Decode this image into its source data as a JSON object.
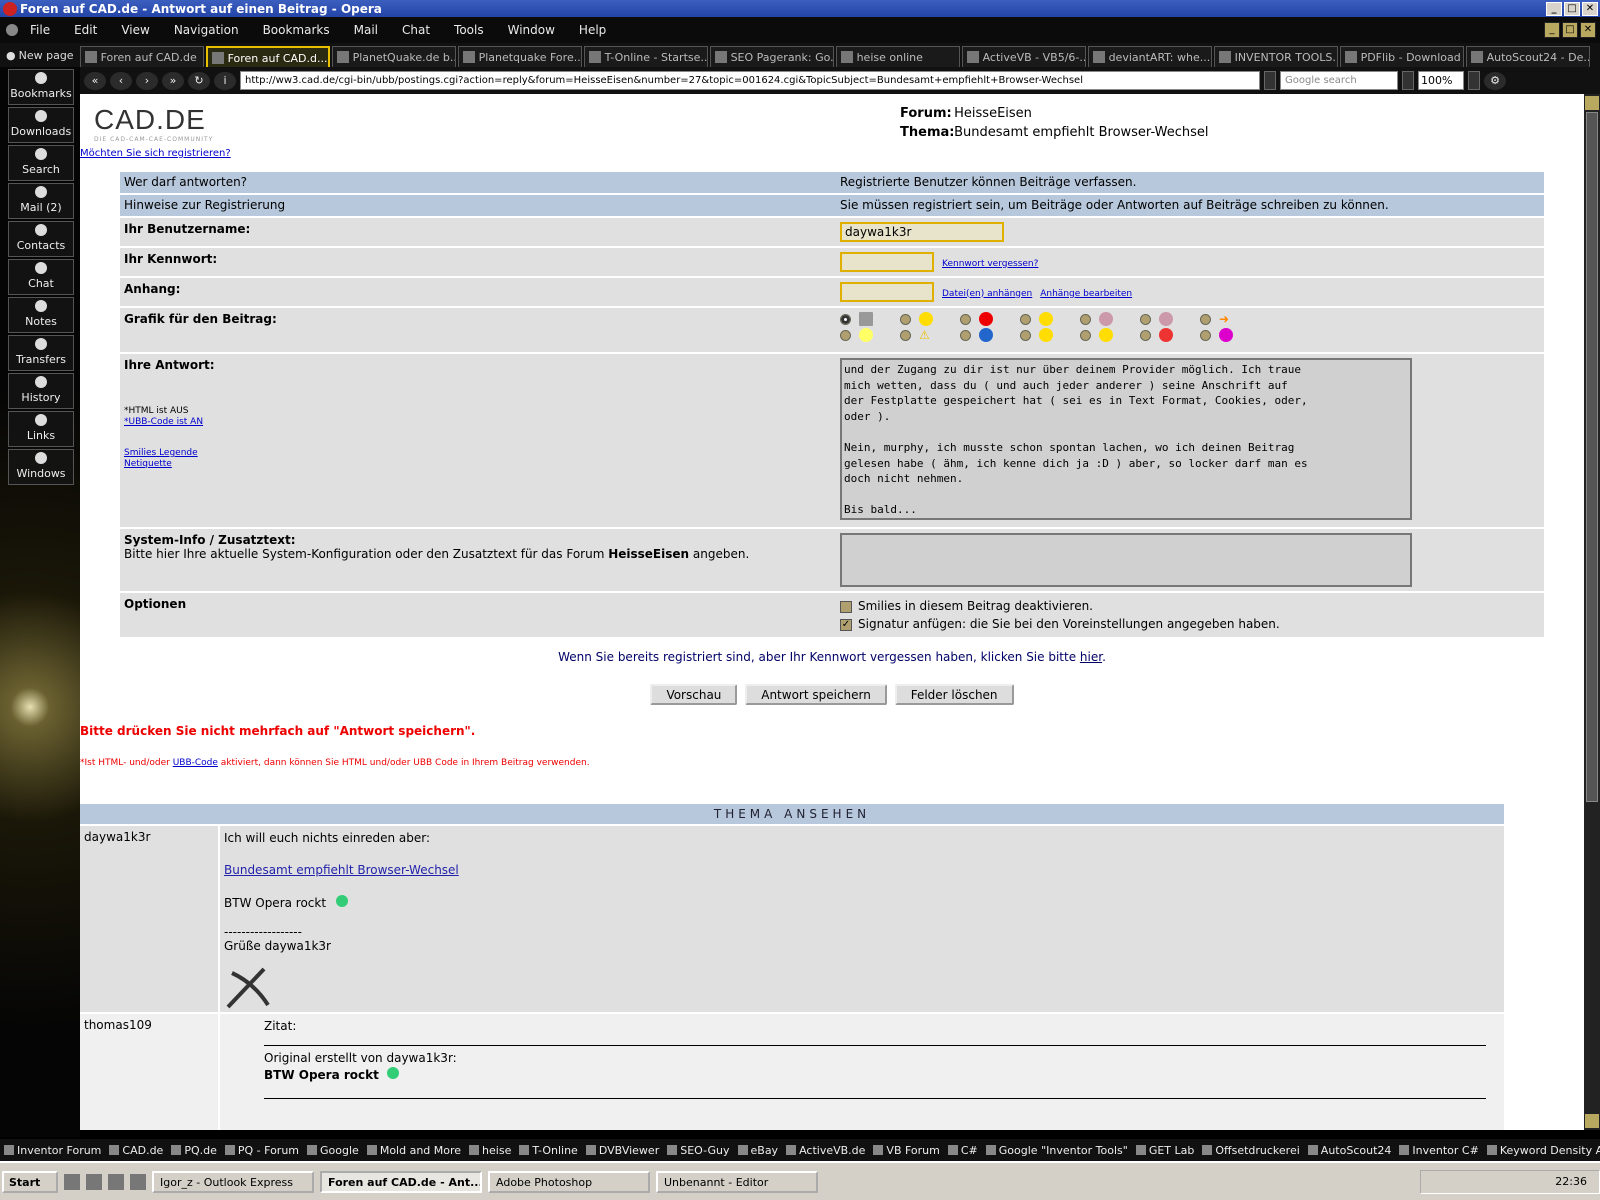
{
  "window": {
    "title": "Foren auf CAD.de - Antwort auf einen Beitrag - Opera"
  },
  "menu": [
    "File",
    "Edit",
    "View",
    "Navigation",
    "Bookmarks",
    "Mail",
    "Chat",
    "Tools",
    "Window",
    "Help"
  ],
  "tabs": {
    "new_page": "New page",
    "items": [
      "Foren auf CAD.de",
      "Foren auf CAD.d...",
      "PlanetQuake.de b...",
      "Planetquake Fore...",
      "T-Online - Startse...",
      "SEO Pagerank: Go...",
      "heise online",
      "ActiveVB - VB5/6-...",
      "deviantART: whe...",
      "INVENTOR TOOLS...",
      "PDFlib - Download ...",
      "AutoScout24 - De..."
    ]
  },
  "address": {
    "url": "http://ww3.cad.de/cgi-bin/ubb/postings.cgi?action=reply&forum=HeisseEisen&number=27&topic=001624.cgi&TopicSubject=Bundesamt+empfiehlt+Browser-Wechsel",
    "search_placeholder": "Google search",
    "zoom": "100%"
  },
  "panel": [
    "Bookmarks",
    "Downloads",
    "Search",
    "Mail (2)",
    "Contacts",
    "Chat",
    "Notes",
    "Transfers",
    "History",
    "Links",
    "Windows"
  ],
  "page": {
    "logo": "CAD.DE",
    "logo_sub": "DIE CAD-CAM-CAE-COMMUNITY",
    "register_link": "Möchten Sie sich registrieren?",
    "forum_label": "Forum:",
    "forum_value": "HeisseEisen",
    "thema_label": "Thema:",
    "thema_value": "Bundesamt empfiehlt Browser-Wechsel",
    "who_label": "Wer darf antworten?",
    "who_value": "Registrierte Benutzer können Beiträge verfassen.",
    "hint_label": "Hinweise zur Registrierung",
    "hint_value": "Sie müssen registriert sein, um Beiträge oder Antworten auf Beiträge schreiben zu können.",
    "user_label": "Ihr Benutzername:",
    "user_value": "daywa1k3r",
    "pass_label": "Ihr Kennwort:",
    "pass_link": "Kennwort vergessen?",
    "attach_label": "Anhang:",
    "attach_link1": "Datei(en) anhängen",
    "attach_link2": "Anhänge bearbeiten",
    "graphic_label": "Grafik für den Beitrag:",
    "answer_label": "Ihre Antwort:",
    "html_off": "*HTML ist AUS",
    "ubb_on": "*UBB-Code ist AN",
    "smilies_legend": "Smilies Legende",
    "netiquette": "Netiquette",
    "answer_text": "und der Zugang zu dir ist nur über deinem Provider möglich. Ich traue\nmich wetten, dass du ( und auch jeder anderer ) seine Anschrift auf\nder Festplatte gespeichert hat ( sei es in Text Format, Cookies, oder,\noder ).\n\nNein, murphy, ich musste schon spontan lachen, wo ich deinen Beitrag\ngelesen habe ( ähm, ich kenne dich ja :D ) aber, so locker darf man es\ndoch nicht nehmen.\n\nBis bald...",
    "sysinfo_label": "System-Info / Zusatztext:",
    "sysinfo_desc_pre": "Bitte hier Ihre aktuelle System-Konfiguration oder den Zusatztext für das Forum ",
    "sysinfo_desc_forum": "HeisseEisen",
    "sysinfo_desc_post": " angeben.",
    "options_label": "Optionen",
    "opt1": "Smilies in diesem Beitrag deaktivieren.",
    "opt2": "Signatur anfügen: die Sie bei den Voreinstellungen angegeben haben.",
    "forgot_pre": "Wenn Sie bereits registriert sind, aber Ihr Kennwort vergessen haben, klicken Sie bitte ",
    "forgot_link": "hier",
    "btn_preview": "Vorschau",
    "btn_save": "Antwort speichern",
    "btn_clear": "Felder löschen",
    "warn": "Bitte drücken Sie nicht mehrfach auf \"Antwort speichern\".",
    "htmlnote_pre": "*Ist HTML- und/oder ",
    "htmlnote_link": "UBB-Code",
    "htmlnote_post": " aktiviert, dann können Sie HTML und/oder UBB Code in Ihrem Beitrag verwenden.",
    "thema_header": "THEMA  ANSEHEN",
    "post1": {
      "author": "daywa1k3r",
      "line1": "Ich will euch nichts einreden aber:",
      "link": "Bundesamt empfiehlt Browser-Wechsel",
      "line2": "BTW Opera rockt",
      "sep": "------------------",
      "greet": "Grüße daywa1k3r"
    },
    "post2": {
      "author": "thomas109",
      "quote": "Zitat:",
      "orig": "Original erstellt von daywa1k3r:",
      "quoted_a": "BTW",
      "quoted_b": " Opera rockt"
    }
  },
  "bookmarks": [
    "Inventor Forum",
    "CAD.de",
    "PQ.de",
    "PQ - Forum",
    "Google",
    "Mold and More",
    "heise",
    "T-Online",
    "DVBViewer",
    "SEO-Guy",
    "eBay",
    "ActiveVB.de",
    "VB Forum",
    "C#",
    "Google \"Inventor Tools\"",
    "GET Lab",
    "Offsetdruckerei",
    "AutoScout24",
    "Inventor C#",
    "Keyword Density Analyzer"
  ],
  "taskbar": {
    "start": "Start",
    "items": [
      "Igor_z - Outlook Express",
      "Foren auf CAD.de - Ant...",
      "Adobe Photoshop",
      "Unbenannt - Editor"
    ],
    "clock": "22:36"
  }
}
